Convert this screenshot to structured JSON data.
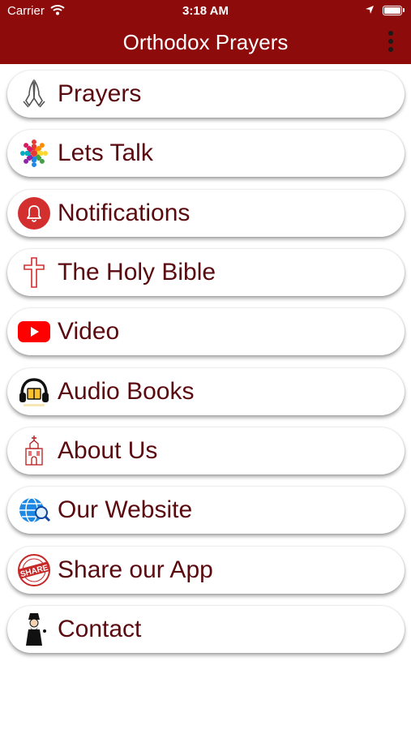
{
  "status_bar": {
    "carrier": "Carrier",
    "time": "3:18 AM"
  },
  "header": {
    "title": "Orthodox Prayers",
    "menu_icon": "more-vertical-icon"
  },
  "colors": {
    "header_bg": "#8e0b0b",
    "label_color": "#5a0a0f"
  },
  "menu": {
    "items": [
      {
        "label": "Prayers",
        "icon": "praying-hands-icon"
      },
      {
        "label": "Lets Talk",
        "icon": "people-circle-icon"
      },
      {
        "label": "Notifications",
        "icon": "bell-icon"
      },
      {
        "label": "The Holy Bible",
        "icon": "cross-icon"
      },
      {
        "label": "Video",
        "icon": "youtube-play-icon"
      },
      {
        "label": "Audio Books",
        "icon": "headphones-book-icon"
      },
      {
        "label": "About Us",
        "icon": "church-icon"
      },
      {
        "label": "Our Website",
        "icon": "globe-search-icon"
      },
      {
        "label": "Share our App",
        "icon": "share-stamp-icon",
        "stamp_text": "SHARE"
      },
      {
        "label": "Contact",
        "icon": "priest-icon"
      }
    ]
  }
}
